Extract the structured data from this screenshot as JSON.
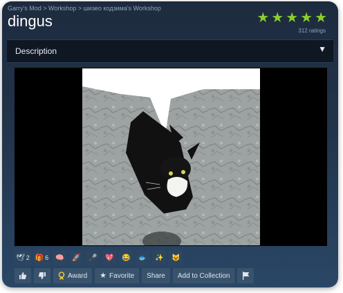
{
  "breadcrumb": "Garry's Mod >  Workshop > шизео кодзима's Workshop",
  "item": {
    "title": "dingus"
  },
  "rating": {
    "stars_filled": 5,
    "stars_total": 5,
    "count_label": "312 ratings"
  },
  "description": {
    "label": "Description"
  },
  "awards": [
    {
      "icon": "wings-icon",
      "glyph": "🕊",
      "count": "2"
    },
    {
      "icon": "gift-icon",
      "glyph": "🎁",
      "count": "6"
    },
    {
      "icon": "brain-icon",
      "glyph": "🧠",
      "count": ""
    },
    {
      "icon": "rocket-icon",
      "glyph": "🚀",
      "count": ""
    },
    {
      "icon": "mic-icon",
      "glyph": "🎤",
      "count": ""
    },
    {
      "icon": "heart-icon",
      "glyph": "💖",
      "count": ""
    },
    {
      "icon": "laugh-icon",
      "glyph": "😂",
      "count": ""
    },
    {
      "icon": "fish-icon",
      "glyph": "🐟",
      "count": ""
    },
    {
      "icon": "sparkle-icon",
      "glyph": "✨",
      "count": ""
    },
    {
      "icon": "mask-icon",
      "glyph": "😺",
      "count": ""
    }
  ],
  "actions": {
    "award_label": "Award",
    "favorite_label": "Favorite",
    "share_label": "Share",
    "collection_label": "Add to Collection"
  },
  "colors": {
    "star": "#8ccd2a",
    "button": "#3a536c",
    "bar": "#0f1722"
  }
}
